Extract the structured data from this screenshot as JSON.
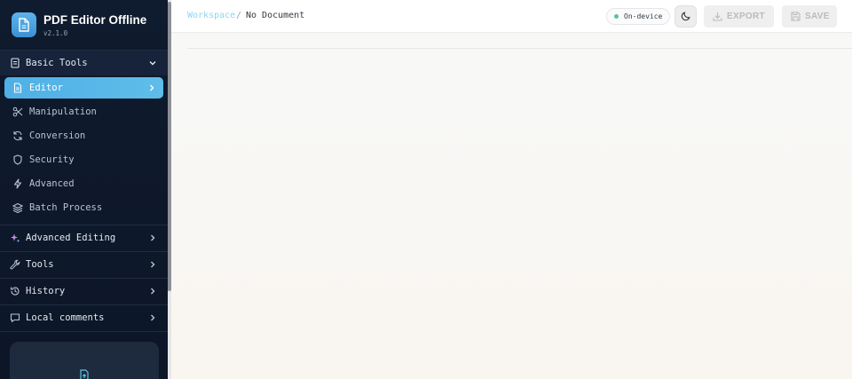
{
  "app": {
    "title": "PDF Editor Offline",
    "version": "v2.1.0"
  },
  "sidebar": {
    "basic_tools": {
      "label": "Basic Tools",
      "items": [
        {
          "label": "Editor",
          "icon": "file-icon",
          "active": true
        },
        {
          "label": "Manipulation",
          "icon": "scissors-icon"
        },
        {
          "label": "Conversion",
          "icon": "refresh-icon"
        },
        {
          "label": "Security",
          "icon": "shield-icon"
        },
        {
          "label": "Advanced",
          "icon": "lightning-icon"
        },
        {
          "label": "Batch Process",
          "icon": "layers-icon"
        }
      ]
    },
    "sections": [
      {
        "label": "Advanced Editing",
        "icon": "sparkles-icon"
      },
      {
        "label": "Tools",
        "icon": "wrench-icon"
      },
      {
        "label": "History",
        "icon": "history-icon"
      },
      {
        "label": "Local comments",
        "icon": "comment-icon"
      }
    ]
  },
  "header": {
    "breadcrumb_root": "Workspace",
    "breadcrumb_separator": "/",
    "document": "No Document",
    "status": "On-device",
    "export_label": "EXPORT",
    "save_label": "SAVE"
  },
  "colors": {
    "accent": "#4fb0e6",
    "sidebar_bg": "#0f1b2e",
    "status_dot": "#53c59b",
    "breadcrumb_link": "#8cd6ef"
  }
}
